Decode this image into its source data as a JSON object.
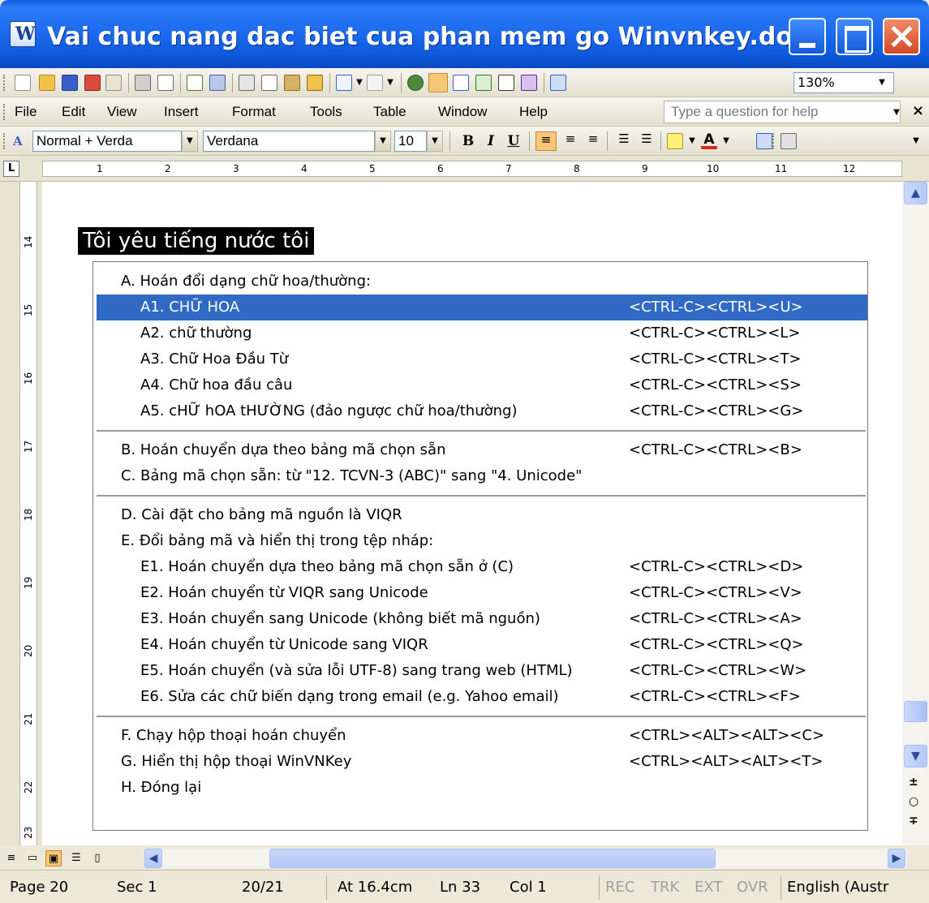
{
  "window": {
    "title": "Vai chuc nang dac biet cua phan mem go Winvnkey.doc - ..."
  },
  "standard_toolbar": {
    "zoom": "130%"
  },
  "menu": {
    "items": [
      "File",
      "Edit",
      "View",
      "Insert",
      "Format",
      "Tools",
      "Table",
      "Window",
      "Help"
    ],
    "help_placeholder": "Type a question for help"
  },
  "formatting_toolbar": {
    "style": "Normal + Verda",
    "font": "Verdana",
    "size": "10",
    "bold": "B",
    "italic": "I",
    "underline": "U"
  },
  "ruler": {
    "numbers": [
      "1",
      "2",
      "3",
      "4",
      "5",
      "6",
      "7",
      "8",
      "9",
      "10",
      "11",
      "12"
    ],
    "vertical_numbers": [
      "14",
      "15",
      "16",
      "17",
      "18",
      "19",
      "20",
      "21",
      "22",
      "23"
    ]
  },
  "document": {
    "heading": "Tôi yêu tiếng nước tôi",
    "rows": [
      {
        "label": "A. Hoán đổi dạng chữ hoa/thường:",
        "shortcut": ""
      },
      {
        "label": "A1. CHỮ HOA",
        "shortcut": "<CTRL-C><CTRL><U>"
      },
      {
        "label": "A2. chữ thường",
        "shortcut": "<CTRL-C><CTRL><L>"
      },
      {
        "label": "A3. Chữ Hoa Đầu Từ",
        "shortcut": "<CTRL-C><CTRL><T>"
      },
      {
        "label": "A4. Chữ hoa đầu câu",
        "shortcut": "<CTRL-C><CTRL><S>"
      },
      {
        "label": "A5. cHỮ hOA tHƯỜNG (đảo ngược chữ hoa/thường)",
        "shortcut": "<CTRL-C><CTRL><G>"
      },
      {
        "label": "B. Hoán chuyển dựa theo bảng mã chọn sẵn",
        "shortcut": "<CTRL-C><CTRL><B>"
      },
      {
        "label": "C. Bảng mã chọn sẵn: từ \"12. TCVN-3 (ABC)\" sang \"4. Unicode\"",
        "shortcut": ""
      },
      {
        "label": "D. Cài đặt cho bảng mã nguồn là VIQR",
        "shortcut": ""
      },
      {
        "label": "E. Đổi bảng mã và hiển thị trong tệp nháp:",
        "shortcut": ""
      },
      {
        "label": "E1. Hoán chuyển dựa theo bảng mã chọn sẵn ở (C)",
        "shortcut": "<CTRL-C><CTRL><D>"
      },
      {
        "label": "E2. Hoán chuyển từ VIQR sang Unicode",
        "shortcut": "<CTRL-C><CTRL><V>"
      },
      {
        "label": "E3. Hoán chuyển sang Unicode (không biết mã nguồn)",
        "shortcut": "<CTRL-C><CTRL><A>"
      },
      {
        "label": "E4. Hoán chuyển từ Unicode sang VIQR",
        "shortcut": "<CTRL-C><CTRL><Q>"
      },
      {
        "label": "E5. Hoán chuyển (và sửa lỗi UTF-8) sang trang web (HTML)",
        "shortcut": "<CTRL-C><CTRL><W>"
      },
      {
        "label": "E6. Sửa các chữ biến dạng trong email (e.g. Yahoo email)",
        "shortcut": "<CTRL-C><CTRL><F>"
      },
      {
        "label": "F. Chạy hộp thoại hoán chuyển",
        "shortcut": "<CTRL><ALT><ALT><C>"
      },
      {
        "label": "G. Hiển thị hộp thoại WinVNKey",
        "shortcut": "<CTRL><ALT><ALT><T>"
      },
      {
        "label": "H. Đóng lại",
        "shortcut": ""
      }
    ]
  },
  "status": {
    "page": "Page 20",
    "sec": "Sec 1",
    "pages": "20/21",
    "at": "At 16.4cm",
    "ln": "Ln 33",
    "col": "Col 1",
    "rec": "REC",
    "trk": "TRK",
    "ext": "EXT",
    "ovr": "OVR",
    "lang": "English (Austr"
  },
  "colors": {
    "selection": "#316ac5",
    "titlebar": "#0b56d8"
  }
}
